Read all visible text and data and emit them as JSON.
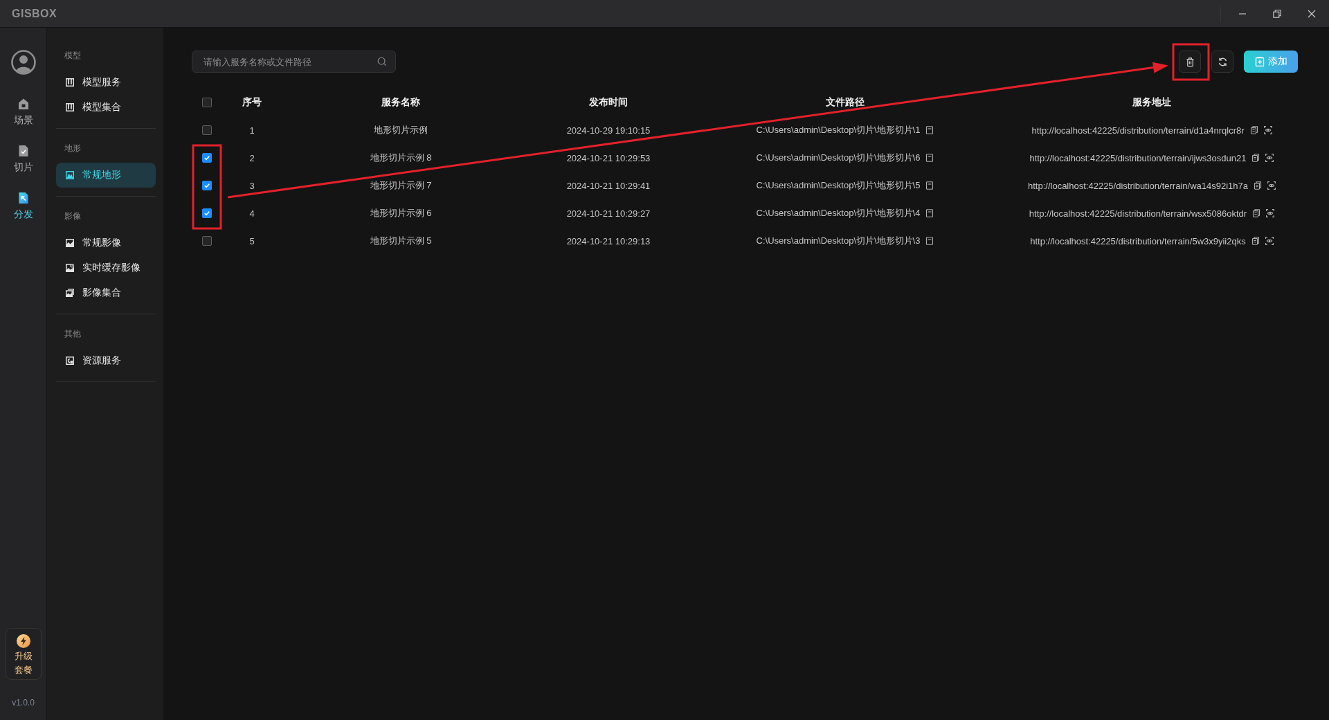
{
  "title_bar": {
    "logo": "GISBOX"
  },
  "rail": {
    "items": [
      {
        "label": "场景",
        "selected": false
      },
      {
        "label": "切片",
        "selected": false
      },
      {
        "label": "分发",
        "selected": true
      }
    ],
    "upgrade_button": "升级套餐",
    "version": "v1.0.0"
  },
  "sidebar": {
    "sections": [
      {
        "title": "模型",
        "items": [
          {
            "label": "模型服务",
            "selected": false
          },
          {
            "label": "模型集合",
            "selected": false
          }
        ]
      },
      {
        "title": "地形",
        "items": [
          {
            "label": "常规地形",
            "selected": true
          }
        ]
      },
      {
        "title": "影像",
        "items": [
          {
            "label": "常规影像",
            "selected": false
          },
          {
            "label": "实时缓存影像",
            "selected": false
          },
          {
            "label": "影像集合",
            "selected": false
          }
        ]
      },
      {
        "title": "其他",
        "items": [
          {
            "label": "资源服务",
            "selected": false
          }
        ]
      }
    ]
  },
  "search": {
    "placeholder": "请输入服务名称或文件路径"
  },
  "toolbar": {
    "add_button": "添加"
  },
  "table": {
    "select_all": {
      "checked": false
    },
    "columns": [
      "序号",
      "服务名称",
      "发布时间",
      "文件路径",
      "服务地址"
    ],
    "rows": [
      {
        "checked": false,
        "cells": [
          "1",
          "地形切片示例",
          "2024-10-29 19:10:15",
          "C:\\Users\\admin\\Desktop\\切片\\地形切片\\1",
          "http://localhost:42225/distribution/terrain/d1a4nrqlcr8r"
        ]
      },
      {
        "checked": true,
        "cells": [
          "2",
          "地形切片示例 8",
          "2024-10-21 10:29:53",
          "C:\\Users\\admin\\Desktop\\切片\\地形切片\\6",
          "http://localhost:42225/distribution/terrain/ijws3osdun21"
        ]
      },
      {
        "checked": true,
        "cells": [
          "3",
          "地形切片示例 7",
          "2024-10-21 10:29:41",
          "C:\\Users\\admin\\Desktop\\切片\\地形切片\\5",
          "http://localhost:42225/distribution/terrain/wa14s92i1h7a"
        ]
      },
      {
        "checked": true,
        "cells": [
          "4",
          "地形切片示例 6",
          "2024-10-21 10:29:27",
          "C:\\Users\\admin\\Desktop\\切片\\地形切片\\4",
          "http://localhost:42225/distribution/terrain/wsx5086oktdr"
        ]
      },
      {
        "checked": false,
        "cells": [
          "5",
          "地形切片示例 5",
          "2024-10-21 10:29:13",
          "C:\\Users\\admin\\Desktop\\切片\\地形切片\\3",
          "http://localhost:42225/distribution/terrain/5w3x9yii2qks"
        ]
      }
    ]
  },
  "annotations": [
    {
      "kind": "frame"
    },
    {
      "kind": "frame"
    },
    {
      "kind": "arrow"
    }
  ]
}
